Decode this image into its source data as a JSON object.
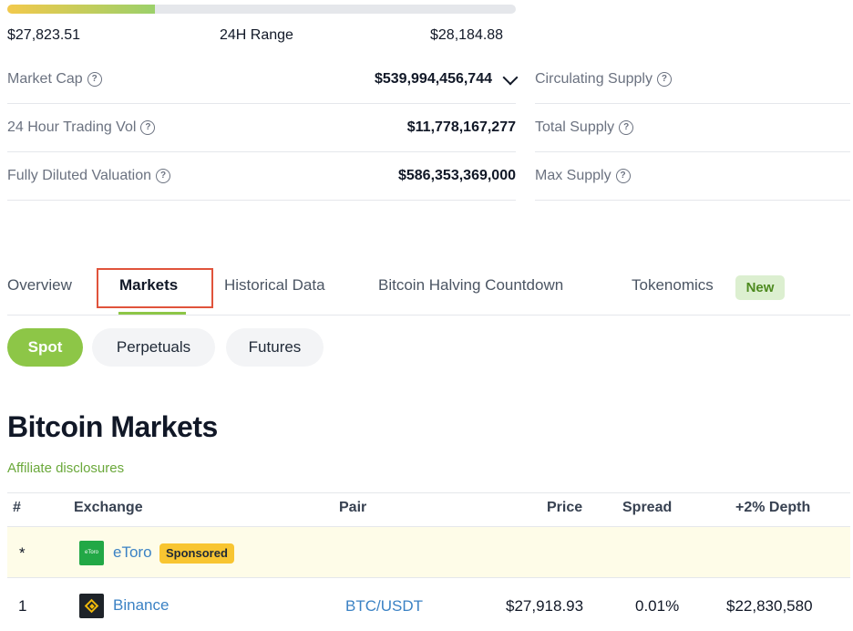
{
  "range": {
    "low": "$27,823.51",
    "label": "24H Range",
    "high": "$28,184.88",
    "position_fraction": 0.29
  },
  "stats_left": [
    {
      "label": "Market Cap",
      "value": "$539,994,456,744",
      "has_dropdown": true
    },
    {
      "label": "24 Hour Trading Vol",
      "value": "$11,778,167,277"
    },
    {
      "label": "Fully Diluted Valuation",
      "value": "$586,353,369,000"
    }
  ],
  "stats_right": [
    {
      "label": "Circulating Supply"
    },
    {
      "label": "Total Supply"
    },
    {
      "label": "Max Supply"
    }
  ],
  "tabs": [
    {
      "label": "Overview"
    },
    {
      "label": "Markets",
      "active": true
    },
    {
      "label": "Historical Data"
    },
    {
      "label": "Bitcoin Halving Countdown"
    },
    {
      "label": "Tokenomics",
      "badge": "New"
    }
  ],
  "market_types": [
    {
      "label": "Spot",
      "active": true
    },
    {
      "label": "Perpetuals"
    },
    {
      "label": "Futures"
    }
  ],
  "section": {
    "title": "Bitcoin Markets",
    "affiliate": "Affiliate disclosures"
  },
  "table": {
    "headers": [
      "#",
      "Exchange",
      "Pair",
      "Price",
      "Spread",
      "+2% Depth"
    ],
    "sponsored": {
      "rank": "*",
      "exchange": "eToro",
      "badge": "Sponsored",
      "logo_text": "eToro"
    },
    "rows": [
      {
        "rank": "1",
        "exchange": "Binance",
        "pair": "BTC/USDT",
        "price": "$27,918.93",
        "spread": "0.01%",
        "depth": "$22,830,580"
      }
    ]
  },
  "colors": {
    "accent": "#8dc647",
    "link": "#3b82c4",
    "highlight_box": "#e0533b",
    "sponsored_badge": "#f8c531"
  }
}
